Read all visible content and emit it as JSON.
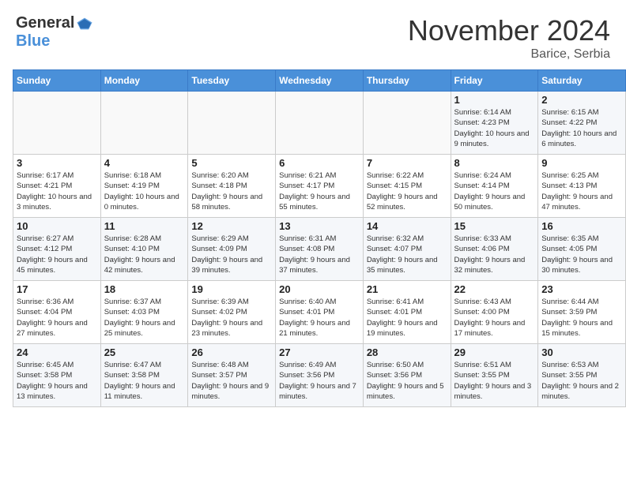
{
  "header": {
    "logo_general": "General",
    "logo_blue": "Blue",
    "month_title": "November 2024",
    "location": "Barice, Serbia"
  },
  "weekdays": [
    "Sunday",
    "Monday",
    "Tuesday",
    "Wednesday",
    "Thursday",
    "Friday",
    "Saturday"
  ],
  "weeks": [
    [
      {
        "day": "",
        "info": ""
      },
      {
        "day": "",
        "info": ""
      },
      {
        "day": "",
        "info": ""
      },
      {
        "day": "",
        "info": ""
      },
      {
        "day": "",
        "info": ""
      },
      {
        "day": "1",
        "info": "Sunrise: 6:14 AM\nSunset: 4:23 PM\nDaylight: 10 hours and 9 minutes."
      },
      {
        "day": "2",
        "info": "Sunrise: 6:15 AM\nSunset: 4:22 PM\nDaylight: 10 hours and 6 minutes."
      }
    ],
    [
      {
        "day": "3",
        "info": "Sunrise: 6:17 AM\nSunset: 4:21 PM\nDaylight: 10 hours and 3 minutes."
      },
      {
        "day": "4",
        "info": "Sunrise: 6:18 AM\nSunset: 4:19 PM\nDaylight: 10 hours and 0 minutes."
      },
      {
        "day": "5",
        "info": "Sunrise: 6:20 AM\nSunset: 4:18 PM\nDaylight: 9 hours and 58 minutes."
      },
      {
        "day": "6",
        "info": "Sunrise: 6:21 AM\nSunset: 4:17 PM\nDaylight: 9 hours and 55 minutes."
      },
      {
        "day": "7",
        "info": "Sunrise: 6:22 AM\nSunset: 4:15 PM\nDaylight: 9 hours and 52 minutes."
      },
      {
        "day": "8",
        "info": "Sunrise: 6:24 AM\nSunset: 4:14 PM\nDaylight: 9 hours and 50 minutes."
      },
      {
        "day": "9",
        "info": "Sunrise: 6:25 AM\nSunset: 4:13 PM\nDaylight: 9 hours and 47 minutes."
      }
    ],
    [
      {
        "day": "10",
        "info": "Sunrise: 6:27 AM\nSunset: 4:12 PM\nDaylight: 9 hours and 45 minutes."
      },
      {
        "day": "11",
        "info": "Sunrise: 6:28 AM\nSunset: 4:10 PM\nDaylight: 9 hours and 42 minutes."
      },
      {
        "day": "12",
        "info": "Sunrise: 6:29 AM\nSunset: 4:09 PM\nDaylight: 9 hours and 39 minutes."
      },
      {
        "day": "13",
        "info": "Sunrise: 6:31 AM\nSunset: 4:08 PM\nDaylight: 9 hours and 37 minutes."
      },
      {
        "day": "14",
        "info": "Sunrise: 6:32 AM\nSunset: 4:07 PM\nDaylight: 9 hours and 35 minutes."
      },
      {
        "day": "15",
        "info": "Sunrise: 6:33 AM\nSunset: 4:06 PM\nDaylight: 9 hours and 32 minutes."
      },
      {
        "day": "16",
        "info": "Sunrise: 6:35 AM\nSunset: 4:05 PM\nDaylight: 9 hours and 30 minutes."
      }
    ],
    [
      {
        "day": "17",
        "info": "Sunrise: 6:36 AM\nSunset: 4:04 PM\nDaylight: 9 hours and 27 minutes."
      },
      {
        "day": "18",
        "info": "Sunrise: 6:37 AM\nSunset: 4:03 PM\nDaylight: 9 hours and 25 minutes."
      },
      {
        "day": "19",
        "info": "Sunrise: 6:39 AM\nSunset: 4:02 PM\nDaylight: 9 hours and 23 minutes."
      },
      {
        "day": "20",
        "info": "Sunrise: 6:40 AM\nSunset: 4:01 PM\nDaylight: 9 hours and 21 minutes."
      },
      {
        "day": "21",
        "info": "Sunrise: 6:41 AM\nSunset: 4:01 PM\nDaylight: 9 hours and 19 minutes."
      },
      {
        "day": "22",
        "info": "Sunrise: 6:43 AM\nSunset: 4:00 PM\nDaylight: 9 hours and 17 minutes."
      },
      {
        "day": "23",
        "info": "Sunrise: 6:44 AM\nSunset: 3:59 PM\nDaylight: 9 hours and 15 minutes."
      }
    ],
    [
      {
        "day": "24",
        "info": "Sunrise: 6:45 AM\nSunset: 3:58 PM\nDaylight: 9 hours and 13 minutes."
      },
      {
        "day": "25",
        "info": "Sunrise: 6:47 AM\nSunset: 3:58 PM\nDaylight: 9 hours and 11 minutes."
      },
      {
        "day": "26",
        "info": "Sunrise: 6:48 AM\nSunset: 3:57 PM\nDaylight: 9 hours and 9 minutes."
      },
      {
        "day": "27",
        "info": "Sunrise: 6:49 AM\nSunset: 3:56 PM\nDaylight: 9 hours and 7 minutes."
      },
      {
        "day": "28",
        "info": "Sunrise: 6:50 AM\nSunset: 3:56 PM\nDaylight: 9 hours and 5 minutes."
      },
      {
        "day": "29",
        "info": "Sunrise: 6:51 AM\nSunset: 3:55 PM\nDaylight: 9 hours and 3 minutes."
      },
      {
        "day": "30",
        "info": "Sunrise: 6:53 AM\nSunset: 3:55 PM\nDaylight: 9 hours and 2 minutes."
      }
    ]
  ]
}
